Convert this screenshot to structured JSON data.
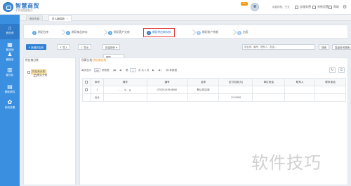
{
  "header": {
    "brand": "智慧商贸",
    "brand_sub": "手机电脑都能记",
    "notice_badge": "9+",
    "user_info": "欢迎你您，王五",
    "links": [
      {
        "label": "云服务费",
        "icon": "cloud-icon"
      },
      {
        "label": "系统设置",
        "icon": "settings-icon"
      },
      {
        "label": "帮助",
        "icon": "help-icon"
      }
    ],
    "gear_icon": "gear-icon"
  },
  "sidebar": {
    "items": [
      {
        "label": "首页资",
        "icon": "home-icon"
      },
      {
        "label": "管进销",
        "icon": "cart-icon"
      },
      {
        "label": "管账务",
        "icon": "user-icon"
      },
      {
        "label": "管分析",
        "icon": "chart-icon"
      },
      {
        "label": "基础资料",
        "icon": "database-icon"
      },
      {
        "label": "系统设置",
        "icon": "settings-icon"
      }
    ]
  },
  "tabs": [
    {
      "label": "首页先前"
    },
    {
      "label": "员人期供新"
    }
  ],
  "steps": [
    {
      "num": "1",
      "label": "期初仓库"
    },
    {
      "num": "2",
      "label": "期初商品库存"
    },
    {
      "num": "3",
      "label": "期初客户欠款"
    },
    {
      "num": "4",
      "label": "期初供应商欠款"
    },
    {
      "num": "5",
      "label": "期初账户余额"
    },
    {
      "num": "6",
      "label": "启用"
    }
  ],
  "toolbar": {
    "add": "新增供应商",
    "import": "导入",
    "export": "导出",
    "batch": "批量操作",
    "batch_menu_item": "删除",
    "search_placeholder": "按名称、编号、联系人、电话...",
    "search_btn": "搜索",
    "advanced_btn": "高级查询搜索"
  },
  "category": {
    "title": "供应商分类",
    "nodes": [
      {
        "label": "供应商分类",
        "selected": true
      },
      {
        "label": "默认分类",
        "selected": false
      }
    ]
  },
  "grid": {
    "heading": "所属分类:",
    "heading_cat": "供应商分类",
    "pager": {
      "prefix": "每页显示",
      "page_size": "10",
      "suffix": "条数据",
      "first": "|◀",
      "prev": "◀",
      "page_label": "第",
      "page": "1",
      "total_pages": "页 共 1 页",
      "next": "▶",
      "last": "▶|",
      "records": "共1条数据"
    },
    "columns": [
      "",
      "序号",
      "操作",
      "编号",
      "名称",
      "应付欠款(元)",
      "单位电话",
      "联系人",
      "联系电话"
    ],
    "rows": [
      {
        "index": "1",
        "code": "07020143918080",
        "name": "默认供应商",
        "debt": "",
        "phone": "",
        "contact": "",
        "mobile": ""
      }
    ],
    "total_label": "合计",
    "total_value": "￥0.0000"
  },
  "watermark": "软件技巧"
}
